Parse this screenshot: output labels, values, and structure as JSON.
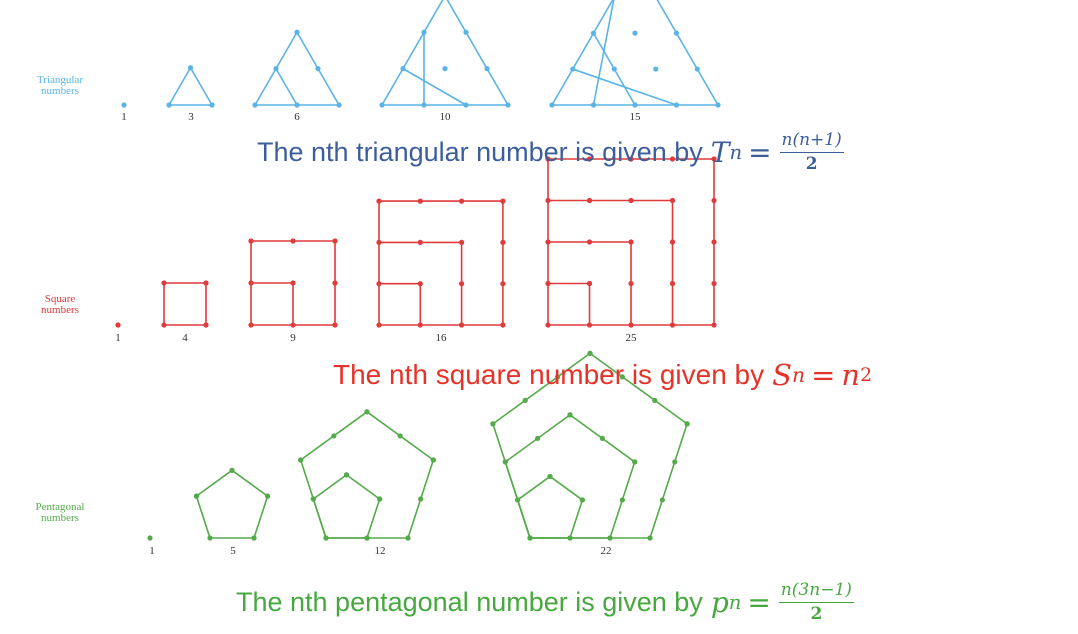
{
  "colors": {
    "triangular": "#5ab4e5",
    "square": "#e03a3a",
    "pentagonal": "#55aa4b",
    "caption_blue": "#3c5f9c",
    "caption_red": "#e5332a",
    "caption_green": "#47a83f"
  },
  "triangular": {
    "label_line1": "Triangular",
    "label_line2": "numbers",
    "counts": [
      "1",
      "3",
      "6",
      "10",
      "15"
    ],
    "caption_text": "The nth triangular number is given by",
    "formula": {
      "lhs": "T",
      "lhs_sub": "n",
      "eq": "=",
      "numerator": "n(n+1)",
      "denominator": "2"
    }
  },
  "square": {
    "label_line1": "Square",
    "label_line2": "numbers",
    "counts": [
      "1",
      "4",
      "9",
      "16",
      "25"
    ],
    "caption_text": "The nth square number is given by",
    "formula": {
      "lhs": "S",
      "lhs_sub": "n",
      "eq": "=",
      "rhs": "n",
      "rhs_sup": "2"
    }
  },
  "pentagonal": {
    "label_line1": "Pentagonal",
    "label_line2": "numbers",
    "counts": [
      "1",
      "5",
      "12",
      "22"
    ],
    "caption_text": "The nth pentagonal number is given by",
    "formula": {
      "lhs": "p",
      "lhs_sub": "n",
      "eq": "=",
      "numerator": "n(3n−1)",
      "denominator": "2"
    }
  }
}
